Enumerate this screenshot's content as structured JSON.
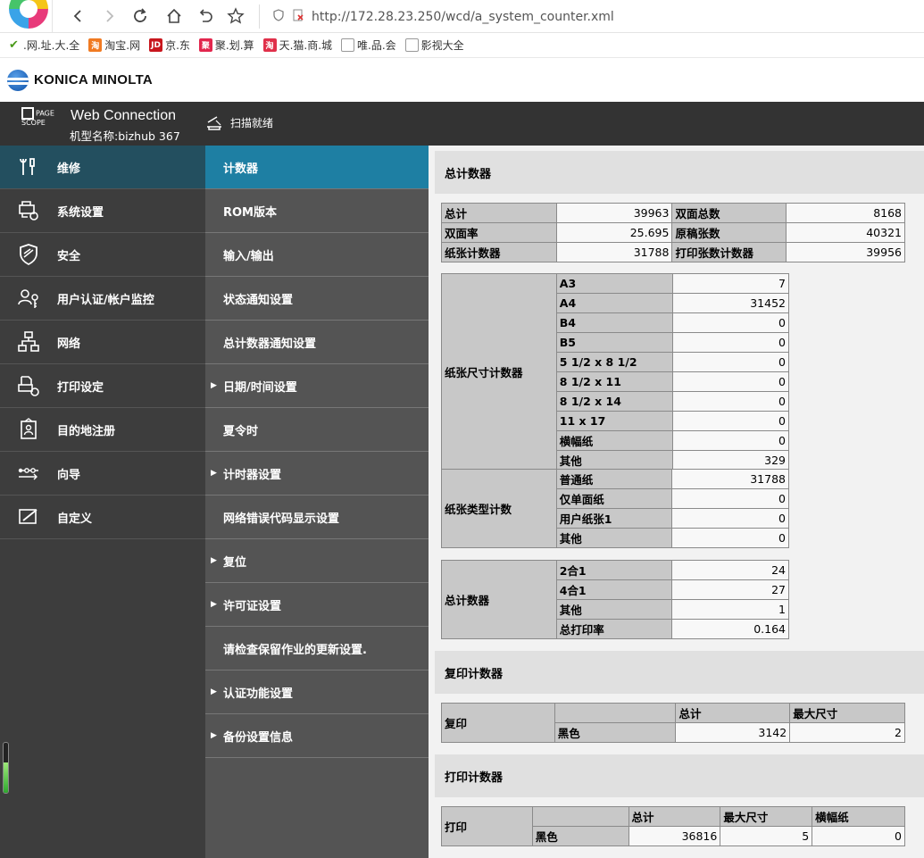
{
  "browser": {
    "url": "http://172.28.23.250/wcd/a_system_counter.xml",
    "bookmarks": [
      ".网.址.大.全",
      "淘宝.网",
      "京.东",
      "聚.划.算",
      "天.猫.商.城",
      "唯.品.会",
      "影视大全"
    ]
  },
  "header": {
    "brand": "KONICA MINOLTA",
    "pagescope": "PAGE SCOPE",
    "app_title": "Web Connection",
    "model": "机型名称:bizhub 367",
    "scan_status": "扫描就绪"
  },
  "sidebar": {
    "items": [
      {
        "label": "维修",
        "icon": "wrench-icon"
      },
      {
        "label": "系统设置",
        "icon": "system-settings-icon"
      },
      {
        "label": "安全",
        "icon": "shield-icon"
      },
      {
        "label": "用户认证/帐户监控",
        "icon": "user-key-icon"
      },
      {
        "label": "网络",
        "icon": "network-icon"
      },
      {
        "label": "打印设定",
        "icon": "print-settings-icon"
      },
      {
        "label": "目的地注册",
        "icon": "address-book-icon"
      },
      {
        "label": "向导",
        "icon": "wizard-icon"
      },
      {
        "label": "自定义",
        "icon": "customize-icon"
      }
    ],
    "progress_fraction": 0.6
  },
  "subnav": {
    "items": [
      {
        "label": "计数器",
        "arrow": ""
      },
      {
        "label": "ROM版本",
        "arrow": ""
      },
      {
        "label": "输入/输出",
        "arrow": ""
      },
      {
        "label": "状态通知设置",
        "arrow": ""
      },
      {
        "label": "总计数器通知设置",
        "arrow": ""
      },
      {
        "label": "日期/时间设置",
        "arrow": "▶"
      },
      {
        "label": "夏令时",
        "arrow": ""
      },
      {
        "label": "计时器设置",
        "arrow": "▶"
      },
      {
        "label": "网络错误代码显示设置",
        "arrow": ""
      },
      {
        "label": "复位",
        "arrow": "▶"
      },
      {
        "label": "许可证设置",
        "arrow": "▶"
      },
      {
        "label": "请检查保留作业的更新设置.",
        "arrow": ""
      },
      {
        "label": "认证功能设置",
        "arrow": "▶"
      },
      {
        "label": "备份设置信息",
        "arrow": "▶"
      }
    ]
  },
  "main": {
    "total_section": {
      "title": "总计数器",
      "summary": [
        [
          "总计",
          "39963",
          "双面总数",
          "8168"
        ],
        [
          "双面率",
          "25.695",
          "原稿张数",
          "40321"
        ],
        [
          "纸张计数器",
          "31788",
          "打印张数计数器",
          "39956"
        ]
      ],
      "paper_size": {
        "group": "纸张尺寸计数器",
        "rows": [
          [
            "A3",
            "7"
          ],
          [
            "A4",
            "31452"
          ],
          [
            "B4",
            "0"
          ],
          [
            "B5",
            "0"
          ],
          [
            "5 1/2 x 8 1/2",
            "0"
          ],
          [
            "8 1/2 x 11",
            "0"
          ],
          [
            "8 1/2 x 14",
            "0"
          ],
          [
            "11 x 17",
            "0"
          ],
          [
            "横幅纸",
            "0"
          ],
          [
            "其他",
            "329"
          ]
        ]
      },
      "paper_type": {
        "group": "纸张类型计数",
        "rows": [
          [
            "普通纸",
            "31788"
          ],
          [
            "仅单面纸",
            "0"
          ],
          [
            "用户纸张1",
            "0"
          ],
          [
            "其他",
            "0"
          ]
        ]
      },
      "total_counter": {
        "group": "总计数器",
        "rows": [
          [
            "2合1",
            "24"
          ],
          [
            "4合1",
            "27"
          ],
          [
            "其他",
            "1"
          ],
          [
            "总打印率",
            "0.164"
          ]
        ]
      }
    },
    "copy_section": {
      "title": "复印计数器",
      "group": "复印",
      "headers": [
        "总计",
        "最大尺寸"
      ],
      "row": [
        "黑色",
        "3142",
        "2"
      ]
    },
    "print_section": {
      "title": "打印计数器",
      "group": "打印",
      "headers": [
        "总计",
        "最大尺寸",
        "横幅纸"
      ],
      "row": [
        "黑色",
        "36816",
        "5",
        "0"
      ]
    }
  }
}
